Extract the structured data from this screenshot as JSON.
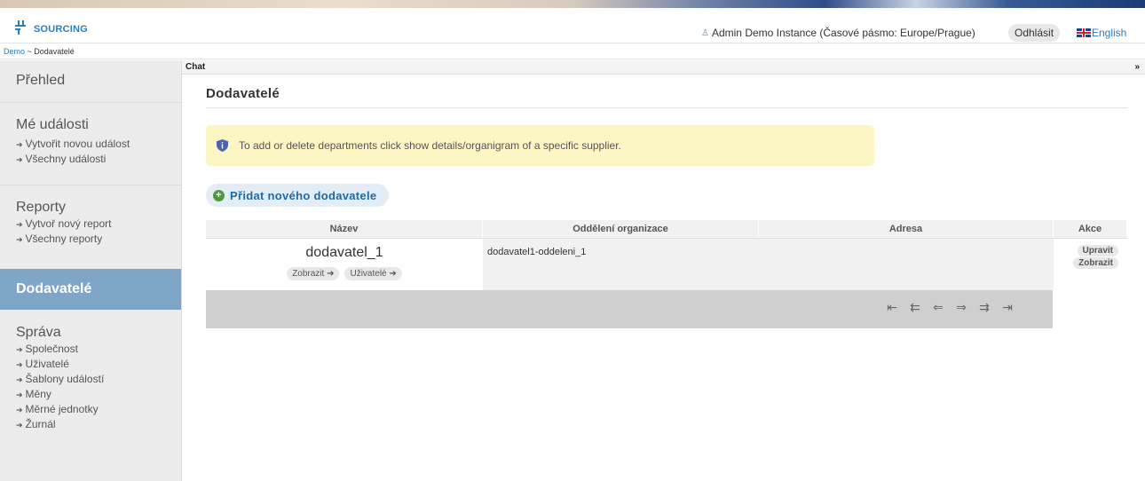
{
  "header": {
    "logo_text": "SOURCING",
    "user_info": "Admin Demo Instance (Časové pásmo: Europe/Prague)",
    "logout_label": "Odhlásit",
    "language_label": "English"
  },
  "breadcrumb": {
    "root": "Demo",
    "separator": " ~ ",
    "current": "Dodavatelé"
  },
  "sidebar": {
    "overview": "Přehled",
    "events": {
      "title": "Mé události",
      "items": [
        {
          "label": "Vytvořit novou událost"
        },
        {
          "label": "Všechny události"
        }
      ]
    },
    "reports": {
      "title": "Reporty",
      "items": [
        {
          "label": "Vytvoř nový report"
        },
        {
          "label": "Všechny reporty"
        }
      ]
    },
    "suppliers_active": "Dodavatelé",
    "admin": {
      "title": "Správa",
      "items": [
        {
          "label": "Společnost"
        },
        {
          "label": "Uživatelé"
        },
        {
          "label": "Šablony událostí"
        },
        {
          "label": "Měny"
        },
        {
          "label": "Měrné jednotky"
        },
        {
          "label": "Žurnál"
        }
      ]
    }
  },
  "chat": {
    "label": "Chat",
    "toggle": "»"
  },
  "main": {
    "title": "Dodavatelé",
    "info_message": "To add or delete departments click show details/organigram of a specific supplier.",
    "add_button": "Přidat nového dodavatele"
  },
  "table": {
    "columns": [
      "Název",
      "Oddělení organizace",
      "Adresa",
      "Akce"
    ],
    "rows": [
      {
        "name": "dodavatel_1",
        "show_label": "Zobrazit",
        "users_label": "Uživatelé",
        "department": "dodavatel1-oddeleni_1",
        "address": "",
        "edit_label": "Upravit",
        "view_label": "Zobrazit"
      }
    ]
  },
  "pager": {
    "first": "⇤",
    "fast_prev": "⇇",
    "prev": "⇐",
    "next": "⇒",
    "fast_next": "⇉",
    "last": "⇥"
  },
  "colors": {
    "brand": "#2a7fc0",
    "active_nav": "#7fa6c6",
    "info_bg": "#fcf5c4",
    "add_icon": "#4c9a3d"
  }
}
